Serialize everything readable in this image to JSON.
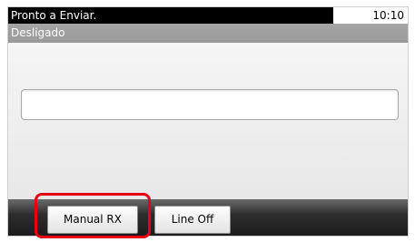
{
  "status_bar": {
    "message": "Pronto a Enviar.",
    "time": "10:10"
  },
  "sub_header": {
    "title": "Desligado"
  },
  "input": {
    "value": ""
  },
  "soft_keys": [
    {
      "label": "Manual RX"
    },
    {
      "label": "Line Off"
    }
  ],
  "colors": {
    "status_bg": "#000000",
    "header_bg": "#a0a0a0",
    "bottom_bar_bg": "#222222",
    "highlight": "#e60012"
  }
}
